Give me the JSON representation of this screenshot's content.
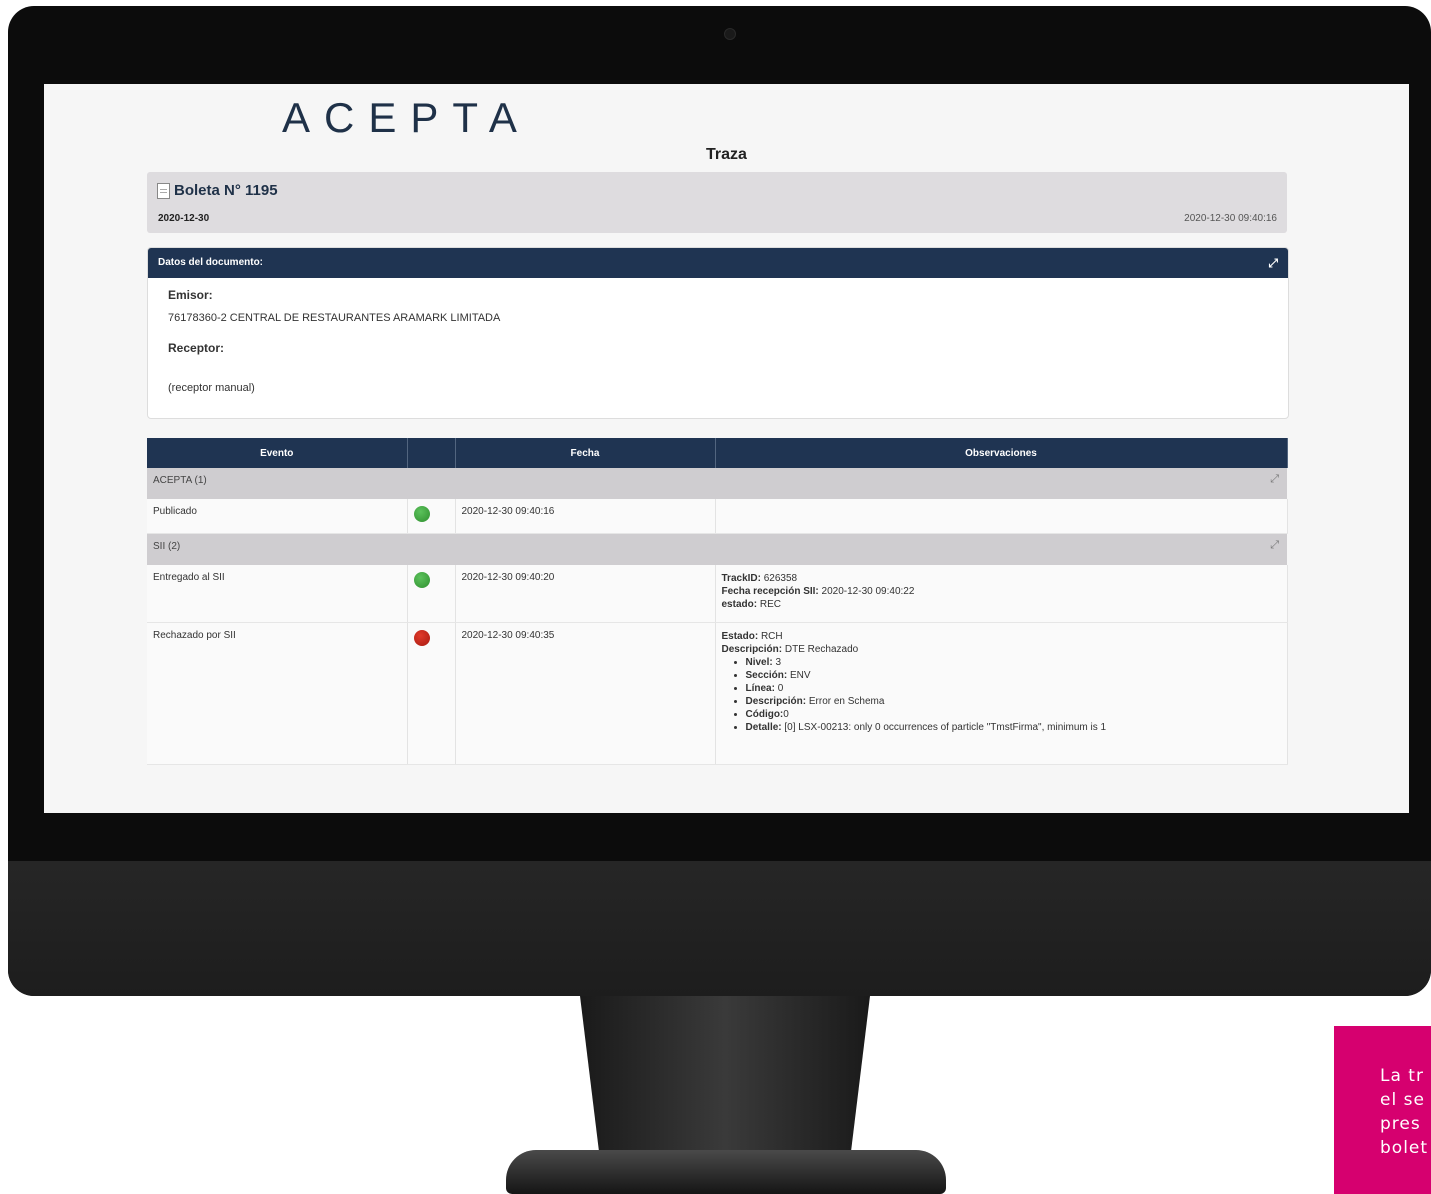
{
  "brand": {
    "logo_text": "ACEPTA"
  },
  "page": {
    "title": "Traza"
  },
  "document": {
    "title": "Boleta N° 1195",
    "date": "2020-12-30",
    "timestamp": "2020-12-30 09:40:16"
  },
  "details_panel": {
    "header": "Datos del documento:",
    "emisor_label": "Emisor:",
    "emisor_value": "76178360-2 CENTRAL DE RESTAURANTES ARAMARK LIMITADA",
    "receptor_label": "Receptor:",
    "receptor_value": "(receptor manual)"
  },
  "events_table": {
    "columns": [
      "Evento",
      "",
      "Fecha",
      "Observaciones"
    ],
    "groups": [
      {
        "label": "ACEPTA (1)",
        "rows": [
          {
            "event": "Publicado",
            "status": "green",
            "date": "2020-12-30 09:40:16"
          }
        ]
      },
      {
        "label": "SII (2)",
        "rows": [
          {
            "event": "Entregado al SII",
            "status": "green",
            "date": "2020-12-30 09:40:20",
            "obs": [
              {
                "k": "TrackID:",
                "v": "626358"
              },
              {
                "k": "Fecha recepción SII:",
                "v": "2020-12-30 09:40:22"
              },
              {
                "k": "estado:",
                "v": "REC"
              }
            ]
          },
          {
            "event": "Rechazado por SII",
            "status": "red",
            "date": "2020-12-30 09:40:35",
            "obs": [
              {
                "k": "Estado:",
                "v": "RCH"
              },
              {
                "k": "Descripción:",
                "v": "DTE Rechazado"
              }
            ],
            "obs_list": [
              {
                "k": "Nivel:",
                "v": "3"
              },
              {
                "k": "Sección:",
                "v": "ENV"
              },
              {
                "k": "Línea:",
                "v": "0"
              },
              {
                "k": "Descripción:",
                "v": "Error en Schema"
              },
              {
                "k": "Código:",
                "v": "0"
              },
              {
                "k": "Detalle:",
                "v": "[0] LSX-00213: only 0 occurrences of particle \"TmstFirma\", minimum is 1"
              }
            ]
          }
        ]
      }
    ]
  },
  "callout": {
    "text": "La tr\nel se\npres\nbolet"
  },
  "colors": {
    "navy": "#1f3452",
    "magenta": "#d6006f",
    "ok": "#3a9e3a",
    "error": "#c0221a"
  }
}
